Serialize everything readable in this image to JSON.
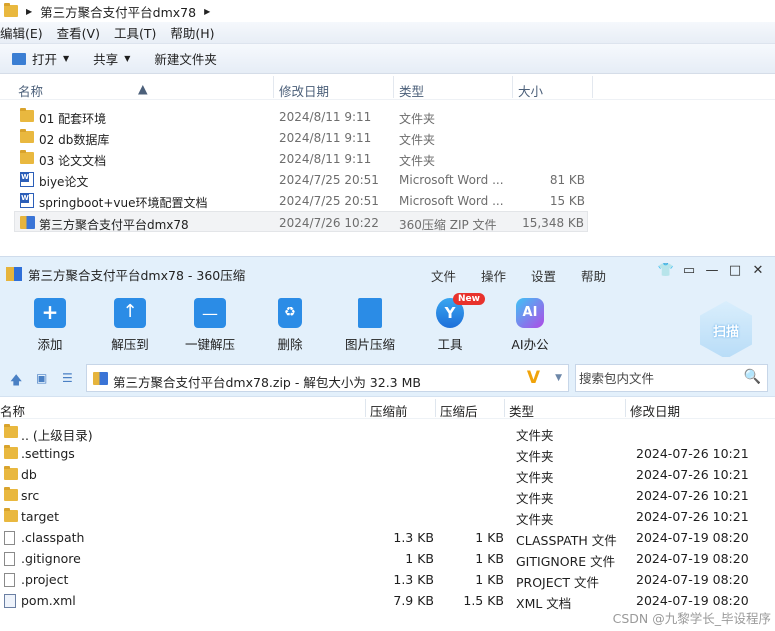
{
  "explorer": {
    "breadcrumb": "第三方聚合支付平台dmx78",
    "menu": [
      "编辑(E)",
      "查看(V)",
      "工具(T)",
      "帮助(H)"
    ],
    "commands": {
      "open": "打开",
      "share": "共享",
      "new_folder": "新建文件夹"
    },
    "columns": {
      "name": "名称",
      "date": "修改日期",
      "type": "类型",
      "size": "大小"
    },
    "rows": [
      {
        "icon": "folder-icon",
        "name": "01 配套环境",
        "date": "2024/8/11 9:11",
        "type": "文件夹",
        "size": ""
      },
      {
        "icon": "folder-icon",
        "name": "02 db数据库",
        "date": "2024/8/11 9:11",
        "type": "文件夹",
        "size": ""
      },
      {
        "icon": "folder-icon",
        "name": "03 论文文档",
        "date": "2024/8/11 9:11",
        "type": "文件夹",
        "size": ""
      },
      {
        "icon": "word-icon",
        "name": "biye论文",
        "date": "2024/7/25 20:51",
        "type": "Microsoft Word ...",
        "size": "81 KB"
      },
      {
        "icon": "word-icon",
        "name": "springboot+vue环境配置文档",
        "date": "2024/7/25 20:51",
        "type": "Microsoft Word ...",
        "size": "15 KB"
      },
      {
        "icon": "zip-icon",
        "name": "第三方聚合支付平台dmx78",
        "date": "2024/7/26 10:22",
        "type": "360压缩 ZIP 文件",
        "size": "15,348 KB"
      }
    ]
  },
  "zip": {
    "title": "第三方聚合支付平台dmx78 - 360压缩",
    "menus": [
      "文件",
      "操作",
      "设置",
      "帮助"
    ],
    "window_buttons": [
      "shirt-icon",
      "feedback-icon",
      "minimize-icon",
      "maximize-icon",
      "close-icon"
    ],
    "tools": [
      {
        "label": "添加",
        "icon": "add-icon"
      },
      {
        "label": "解压到",
        "icon": "extract-icon"
      },
      {
        "label": "一键解压",
        "icon": "one-click-extract-icon"
      },
      {
        "label": "删除",
        "icon": "delete-icon"
      },
      {
        "label": "图片压缩",
        "icon": "image-compress-icon"
      },
      {
        "label": "工具",
        "icon": "tools-icon"
      },
      {
        "label": "AI办公",
        "icon": "ai-office-icon"
      }
    ],
    "new_badge": "New",
    "scan_label": "扫描",
    "path": "第三方聚合支付平台dmx78.zip - 解包大小为 32.3 MB",
    "search_placeholder": "搜索包内文件",
    "columns": {
      "name": "名称",
      "original": "压缩前",
      "compressed": "压缩后",
      "type": "类型",
      "date": "修改日期"
    },
    "rows": [
      {
        "icon": "folder-icon",
        "name": ".. (上级目录)",
        "original": "",
        "compressed": "",
        "type": "文件夹",
        "date": ""
      },
      {
        "icon": "folder-icon",
        "name": ".settings",
        "original": "",
        "compressed": "",
        "type": "文件夹",
        "date": "2024-07-26 10:21"
      },
      {
        "icon": "folder-icon",
        "name": "db",
        "original": "",
        "compressed": "",
        "type": "文件夹",
        "date": "2024-07-26 10:21"
      },
      {
        "icon": "folder-icon",
        "name": "src",
        "original": "",
        "compressed": "",
        "type": "文件夹",
        "date": "2024-07-26 10:21"
      },
      {
        "icon": "folder-icon",
        "name": "target",
        "original": "",
        "compressed": "",
        "type": "文件夹",
        "date": "2024-07-26 10:21"
      },
      {
        "icon": "file-icon",
        "name": ".classpath",
        "original": "1.3 KB",
        "compressed": "1 KB",
        "type": "CLASSPATH 文件",
        "date": "2024-07-19 08:20"
      },
      {
        "icon": "file-icon",
        "name": ".gitignore",
        "original": "1 KB",
        "compressed": "1 KB",
        "type": "GITIGNORE 文件",
        "date": "2024-07-19 08:20"
      },
      {
        "icon": "file-icon",
        "name": ".project",
        "original": "1.3 KB",
        "compressed": "1 KB",
        "type": "PROJECT 文件",
        "date": "2024-07-19 08:20"
      },
      {
        "icon": "xml-icon",
        "name": "pom.xml",
        "original": "7.9 KB",
        "compressed": "1.5 KB",
        "type": "XML 文档",
        "date": "2024-07-19 08:20"
      }
    ]
  },
  "watermark": "CSDN @九黎学长_毕设程序"
}
